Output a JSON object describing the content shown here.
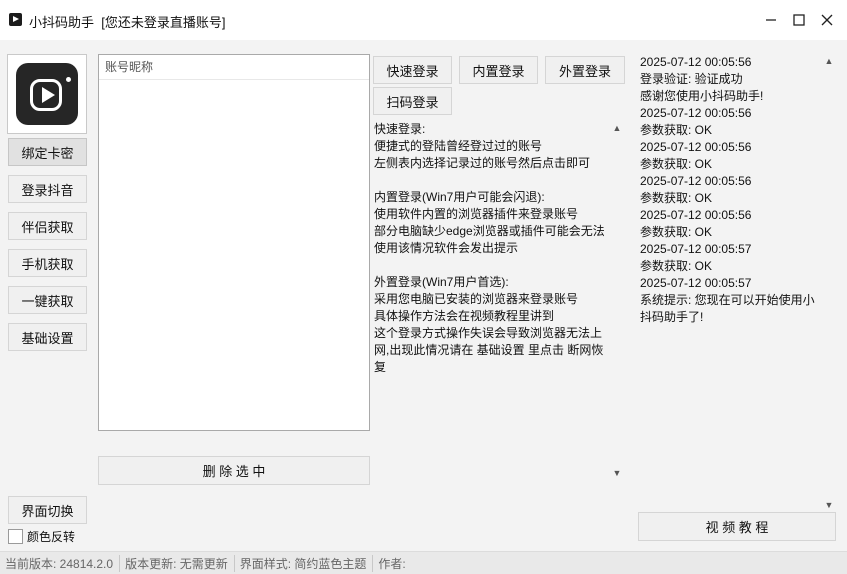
{
  "window": {
    "app_name": "小抖码助手",
    "status": "[您还未登录直播账号]",
    "controls": {
      "minimize": "—",
      "maximize": "☐",
      "close": "✕"
    }
  },
  "sidebar": {
    "items": [
      {
        "label": "绑定卡密"
      },
      {
        "label": "登录抖音"
      },
      {
        "label": "伴侣获取"
      },
      {
        "label": "手机获取"
      },
      {
        "label": "一键获取"
      },
      {
        "label": "基础设置"
      }
    ],
    "switch_label": "界面切换",
    "invert_label": "颜色反转",
    "invert_checked": false
  },
  "account_list": {
    "header": "账号昵称",
    "delete_label": "删 除 选 中"
  },
  "login": {
    "quick": "快速登录",
    "builtin": "内置登录",
    "external": "外置登录",
    "scan": "扫码登录",
    "help_text": "快速登录:\n便捷式的登陆曾经登过过的账号\n左侧表内选择记录过的账号然后点击即可\n\n内置登录(Win7用户可能会闪退):\n使用软件内置的浏览器插件来登录账号\n部分电脑缺少edge浏览器或插件可能会无法使用该情况软件会发出提示\n\n外置登录(Win7用户首选):\n采用您电脑已安装的浏览器来登录账号\n具体操作方法会在视频教程里讲到\n这个登录方式操作失误会导致浏览器无法上网,出现此情况请在 基础设置 里点击 断网恢复"
  },
  "log": {
    "text": "2025-07-12 00:05:56\n登录验证: 验证成功\n感谢您使用小抖码助手!\n2025-07-12 00:05:56\n参数获取: OK\n2025-07-12 00:05:56\n参数获取: OK\n2025-07-12 00:05:56\n参数获取: OK\n2025-07-12 00:05:56\n参数获取: OK\n2025-07-12 00:05:57\n参数获取: OK\n2025-07-12 00:05:57\n系统提示: 您现在可以开始使用小抖码助手了!",
    "video_button": "视 频 教 程"
  },
  "statusbar": {
    "version": "当前版本: 24814.2.0",
    "update": "版本更新: 无需更新",
    "theme": "界面样式: 简约蓝色主题",
    "author": "作者:"
  },
  "icons": {
    "scroll_up": "▲",
    "scroll_down": "▼"
  }
}
